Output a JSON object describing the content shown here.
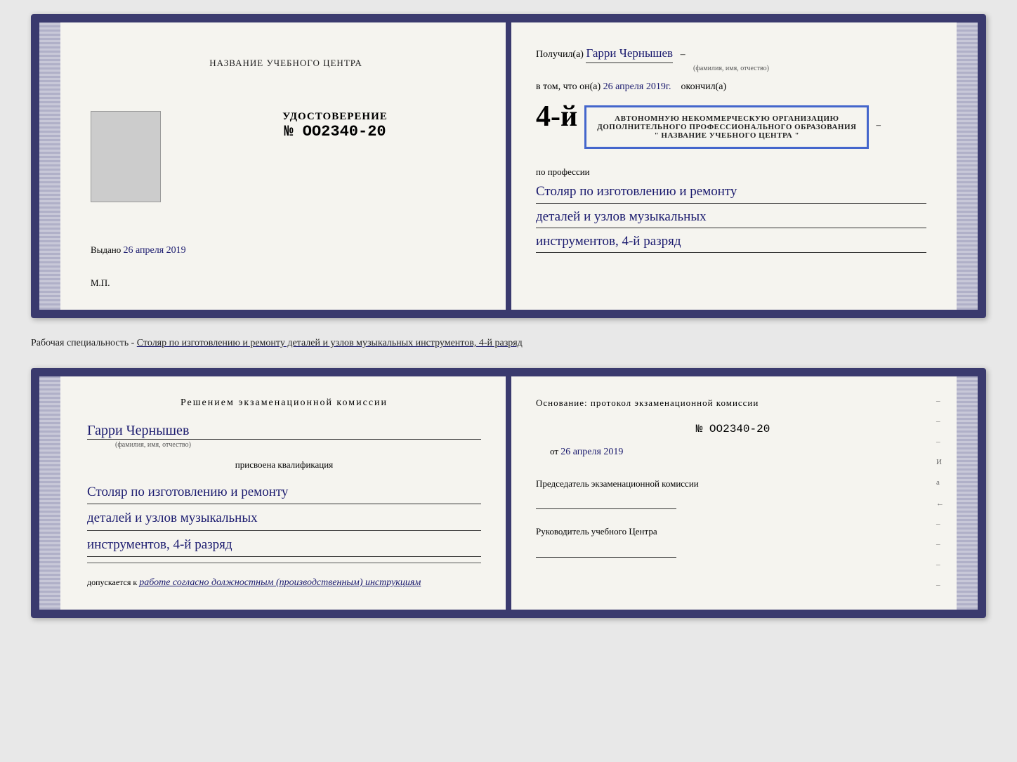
{
  "top_spread": {
    "left_page": {
      "center_title": "НАЗВАНИЕ УЧЕБНОГО ЦЕНТРА",
      "cert_label": "УДОСТОВЕРЕНИЕ",
      "cert_number": "№ OO2340-20",
      "issued_label": "Выдано",
      "issued_date": "26 апреля 2019",
      "mp_label": "М.П."
    },
    "right_page": {
      "received_label": "Получил(а)",
      "recipient_name": "Гарри Чернышев",
      "fio_subtitle": "(фамилия, имя, отчество)",
      "in_that_label": "в том, что он(а)",
      "date_label": "26 апреля 2019г.",
      "finished_label": "окончил(а)",
      "stamp_line1": "АВТОНОМНУЮ НЕКОММЕРЧЕСКУЮ ОРГАНИЗАЦИЮ",
      "stamp_line2": "ДОПОЛНИТЕЛЬНОГО ПРОФЕССИОНАЛЬНОГО ОБРАЗОВАНИЯ",
      "stamp_line3": "\" НАЗВАНИЕ УЧЕБНОГО ЦЕНТРА \"",
      "stamp_big": "4-й",
      "by_profession_label": "по профессии",
      "profession_line1": "Столяр по изготовлению и ремонту",
      "profession_line2": "деталей и узлов музыкальных",
      "profession_line3": "инструментов, 4-й разряд"
    }
  },
  "description": {
    "text": "Рабочая специальность - Столяр по изготовлению и ремонту деталей и узлов музыкальных инструментов, 4-й разряд"
  },
  "bottom_spread": {
    "left_page": {
      "decision_title": "Решением  экзаменационной  комиссии",
      "person_name": "Гарри Чернышев",
      "fio_subtitle": "(фамилия, имя, отчество)",
      "assigned_label": "присвоена квалификация",
      "qualification_line1": "Столяр по изготовлению и ремонту",
      "qualification_line2": "деталей и узлов музыкальных",
      "qualification_line3": "инструментов, 4-й разряд",
      "allowed_label": "допускается к",
      "allowed_value": "работе согласно должностным (производственным) инструкциям"
    },
    "right_page": {
      "basis_label": "Основание: протокол экзаменационной  комиссии",
      "protocol_number": "№  OO2340-20",
      "date_from": "от",
      "date_value": "26 апреля 2019",
      "chairman_label": "Председатель экзаменационной комиссии",
      "director_label": "Руководитель учебного Центра"
    },
    "side_marks": [
      "–",
      "–",
      "–",
      "И",
      "а",
      "←",
      "–",
      "–",
      "–",
      "–"
    ]
  }
}
